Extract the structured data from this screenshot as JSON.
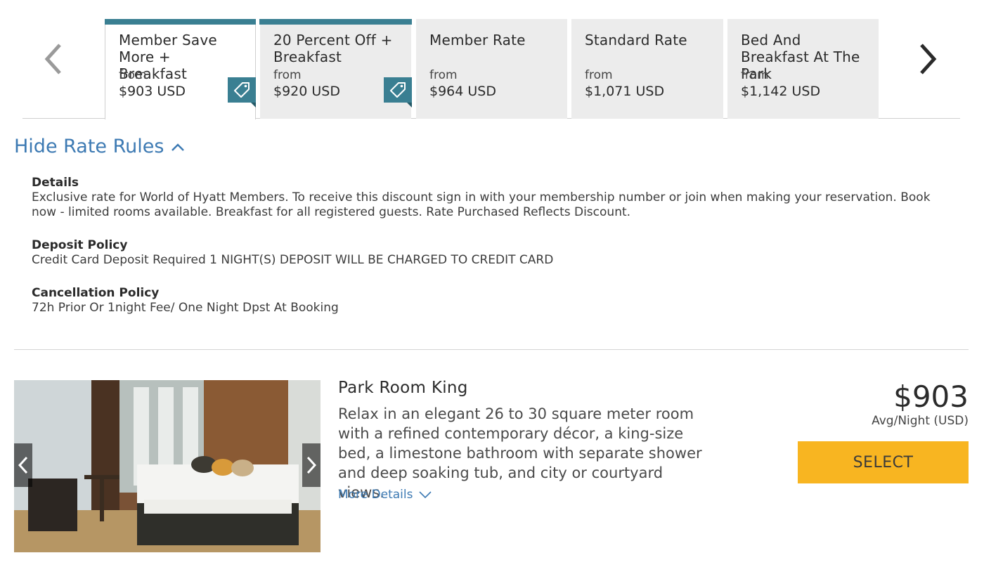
{
  "carousel": {
    "prev_icon": "chevron-left-icon",
    "next_icon": "chevron-right-icon",
    "tabs": [
      {
        "name": "Member Save More + Breakfast",
        "from": "from",
        "price": "$903 USD",
        "offer_icon": "price-tag-icon"
      },
      {
        "name": "20 Percent Off + Breakfast",
        "from": "from",
        "price": "$920 USD",
        "offer_icon": "price-tag-icon"
      },
      {
        "name": "Member Rate",
        "from": "from",
        "price": "$964 USD"
      },
      {
        "name": "Standard Rate",
        "from": "from",
        "price": "$1,071 USD"
      },
      {
        "name": "Bed And Breakfast At The Park",
        "from": "from",
        "price": "$1,142 USD"
      }
    ],
    "selected_index": 0
  },
  "rate_rules": {
    "toggle_label": "Hide Rate Rules",
    "toggle_icon": "chevron-up-icon",
    "sections": [
      {
        "title": "Details",
        "text": "Exclusive rate for World of Hyatt Members. To receive this discount sign in with your membership number or join when making your reservation. Book now - limited rooms available. Breakfast for all registered guests. Rate Purchased Reflects Discount."
      },
      {
        "title": "Deposit Policy",
        "text": "Credit Card Deposit Required 1 NIGHT(S) DEPOSIT WILL BE CHARGED TO CREDIT CARD"
      },
      {
        "title": "Cancellation Policy",
        "text": "72h Prior Or 1night Fee/ One Night Dpst At Booking"
      }
    ]
  },
  "room": {
    "name": "Park Room King",
    "description": "Relax in an elegant 26 to 30 square meter room with a refined contemporary décor, a king-size bed, a limestone bathroom with separate shower and deep soaking tub, and city or courtyard views.",
    "more_details_label": "More Details",
    "more_details_icon": "chevron-down-icon",
    "price": "$903",
    "price_note": "Avg/Night (USD)",
    "select_label": "SELECT",
    "photo": "hotel-room-photo"
  },
  "colors": {
    "accent_teal": "#3a7f92",
    "link_blue": "#3d7ab3",
    "select_yellow": "#f8b521",
    "tab_grey": "#ececec"
  }
}
